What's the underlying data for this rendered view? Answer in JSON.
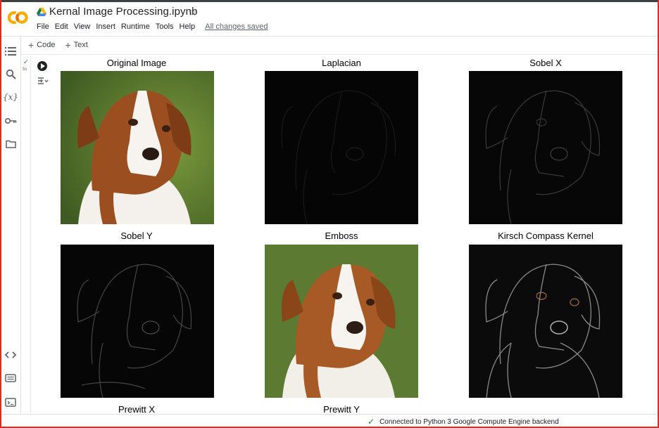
{
  "app": {
    "logo_text": "CO",
    "notebook_title": "Kernal Image Processing.ipynb",
    "menu": [
      "File",
      "Edit",
      "View",
      "Insert",
      "Runtime",
      "Tools",
      "Help"
    ],
    "save_status": "All changes saved"
  },
  "toolbar": {
    "code_label": "Code",
    "text_label": "Text"
  },
  "rail": {
    "variables_label": "{x}"
  },
  "cell": {
    "exec_time": "5s",
    "output_panels": [
      {
        "title": "Original Image"
      },
      {
        "title": "Laplacian"
      },
      {
        "title": "Sobel X"
      },
      {
        "title": "Sobel Y"
      },
      {
        "title": "Emboss"
      },
      {
        "title": "Kirsch Compass Kernel"
      },
      {
        "title": "Prewitt X"
      },
      {
        "title": "Prewitt Y"
      }
    ]
  },
  "status": {
    "text": "Connected to Python 3 Google Compute Engine backend"
  },
  "colors": {
    "accent_red": "#d93025",
    "logo_orange": "#f9ab00",
    "logo_orange_dark": "#e37400",
    "success_green": "#188038"
  }
}
